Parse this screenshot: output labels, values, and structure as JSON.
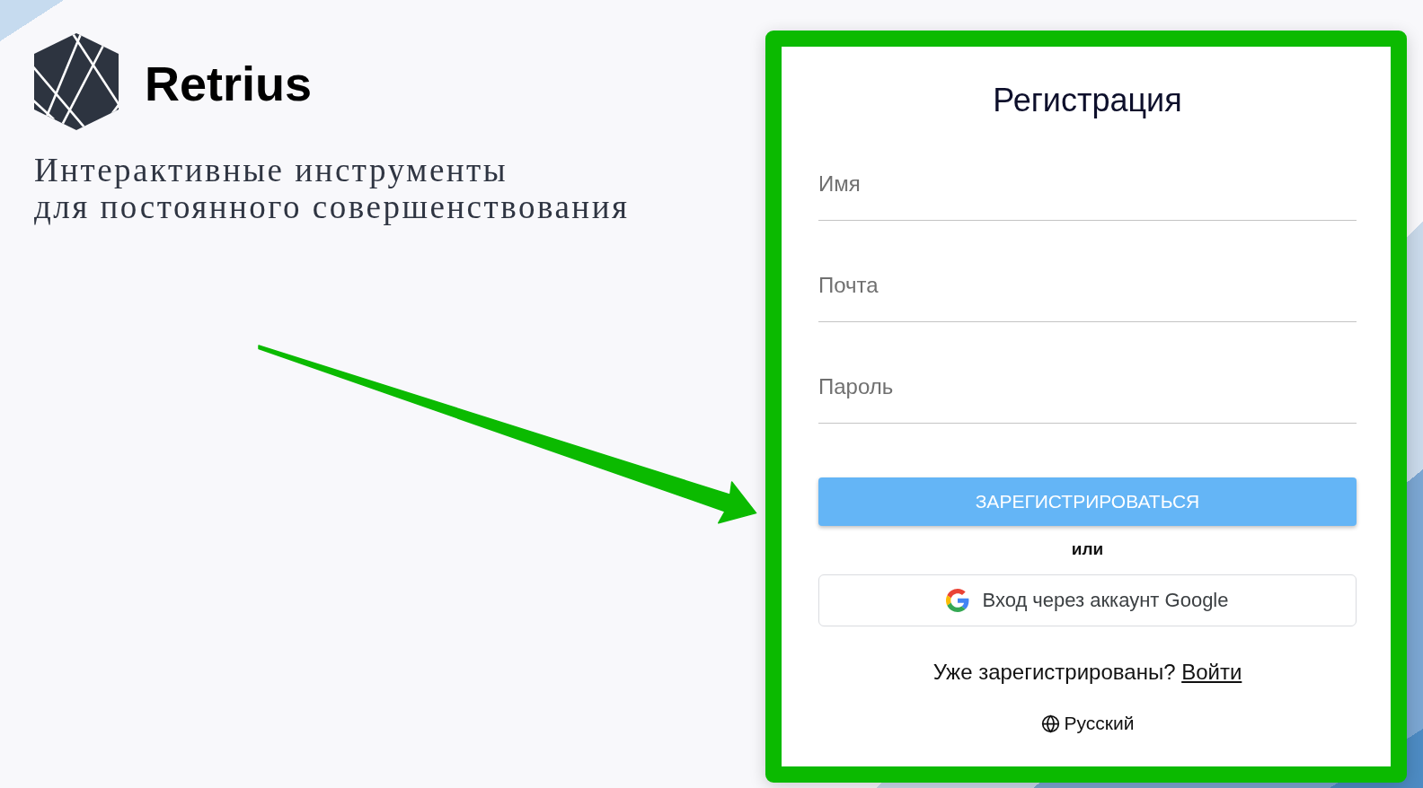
{
  "brand": {
    "name": "Retrius",
    "tagline": [
      "Интерактивные инструменты",
      "для постоянного совершенствования"
    ]
  },
  "form": {
    "title": "Регистрация",
    "fields": [
      {
        "placeholder": "Имя"
      },
      {
        "placeholder": "Почта"
      },
      {
        "placeholder": "Пароль"
      }
    ],
    "submit_button": "ЗАРЕГИСТРИРОВАТЬСЯ",
    "separator": "или",
    "google_button": "Вход через аккаунт Google",
    "login_prompt": {
      "text": "Уже зарегистрированы?",
      "link": "Войти"
    },
    "language": "Русский"
  }
}
